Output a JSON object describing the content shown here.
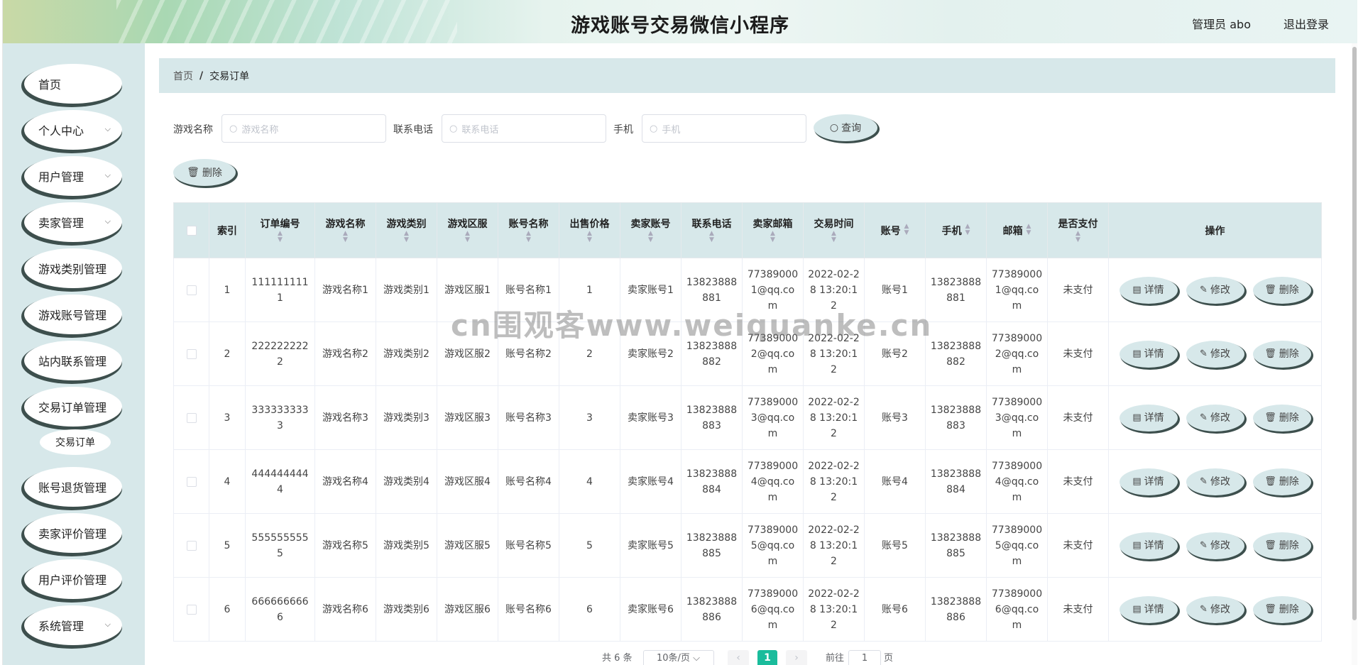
{
  "header": {
    "title": "游戏账号交易微信小程序",
    "user": "管理员 abo",
    "logout": "退出登录"
  },
  "sidebar": {
    "items": [
      {
        "label": "首页",
        "arrow": ""
      },
      {
        "label": "个人中心",
        "arrow": "⌵"
      },
      {
        "label": "用户管理",
        "arrow": "⌵"
      },
      {
        "label": "卖家管理",
        "arrow": "⌵"
      },
      {
        "label": "游戏类别管理",
        "arrow": ""
      },
      {
        "label": "游戏账号管理",
        "arrow": ""
      },
      {
        "label": "站内联系管理",
        "arrow": ""
      },
      {
        "label": "交易订单管理",
        "arrow": ""
      },
      {
        "label": "账号退货管理",
        "arrow": ""
      },
      {
        "label": "卖家评价管理",
        "arrow": ""
      },
      {
        "label": "用户评价管理",
        "arrow": ""
      },
      {
        "label": "系统管理",
        "arrow": "⌵"
      }
    ],
    "submenu": {
      "label": "交易订单"
    }
  },
  "breadcrumb": {
    "home": "首页",
    "sep": "/",
    "current": "交易订单"
  },
  "search": {
    "game_name_label": "游戏名称",
    "game_name_placeholder": "游戏名称",
    "phone_label": "联系电话",
    "phone_placeholder": "联系电话",
    "mobile_label": "手机",
    "mobile_placeholder": "手机",
    "query_button": "查询",
    "search_icon": "search-icon"
  },
  "toolbar": {
    "delete_button": "删除"
  },
  "table": {
    "headers": [
      "索引",
      "订单编号",
      "游戏名称",
      "游戏类别",
      "游戏区服",
      "账号名称",
      "出售价格",
      "卖家账号",
      "联系电话",
      "卖家邮箱",
      "交易时间",
      "账号",
      "手机",
      "邮箱",
      "是否支付",
      "操作"
    ],
    "rows": [
      [
        "1",
        "1111111111",
        "游戏名称1",
        "游戏类别1",
        "游戏区服1",
        "账号名称1",
        "1",
        "卖家账号1",
        "13823888881",
        "773890001@qq.com",
        "2022-02-28 13:20:12",
        "账号1",
        "13823888881",
        "773890001@qq.com",
        "未支付"
      ],
      [
        "2",
        "2222222222",
        "游戏名称2",
        "游戏类别2",
        "游戏区服2",
        "账号名称2",
        "2",
        "卖家账号2",
        "13823888882",
        "773890002@qq.com",
        "2022-02-28 13:20:12",
        "账号2",
        "13823888882",
        "773890002@qq.com",
        "未支付"
      ],
      [
        "3",
        "3333333333",
        "游戏名称3",
        "游戏类别3",
        "游戏区服3",
        "账号名称3",
        "3",
        "卖家账号3",
        "13823888883",
        "773890003@qq.com",
        "2022-02-28 13:20:12",
        "账号3",
        "13823888883",
        "773890003@qq.com",
        "未支付"
      ],
      [
        "4",
        "4444444444",
        "游戏名称4",
        "游戏类别4",
        "游戏区服4",
        "账号名称4",
        "4",
        "卖家账号4",
        "13823888884",
        "773890004@qq.com",
        "2022-02-28 13:20:12",
        "账号4",
        "13823888884",
        "773890004@qq.com",
        "未支付"
      ],
      [
        "5",
        "5555555555",
        "游戏名称5",
        "游戏类别5",
        "游戏区服5",
        "账号名称5",
        "5",
        "卖家账号5",
        "13823888885",
        "773890005@qq.com",
        "2022-02-28 13:20:12",
        "账号5",
        "13823888885",
        "773890005@qq.com",
        "未支付"
      ],
      [
        "6",
        "6666666666",
        "游戏名称6",
        "游戏类别6",
        "游戏区服6",
        "账号名称6",
        "6",
        "卖家账号6",
        "13823888886",
        "773890006@qq.com",
        "2022-02-28 13:20:12",
        "账号6",
        "13823888886",
        "773890006@qq.com",
        "未支付"
      ]
    ],
    "row_actions": {
      "detail": "详情",
      "edit": "修改",
      "delete": "删除"
    }
  },
  "pagination": {
    "total": "共 6 条",
    "page_size": "10条/页",
    "current": "1",
    "goto": "前往",
    "goto_value": "1",
    "page_unit": "页"
  },
  "watermark": "cn围观客www.weiquanke.cn",
  "colors": {
    "accent": "#d7e8ea",
    "button_shadow": "#3d4f4d",
    "current_page": "#1abc9c"
  }
}
